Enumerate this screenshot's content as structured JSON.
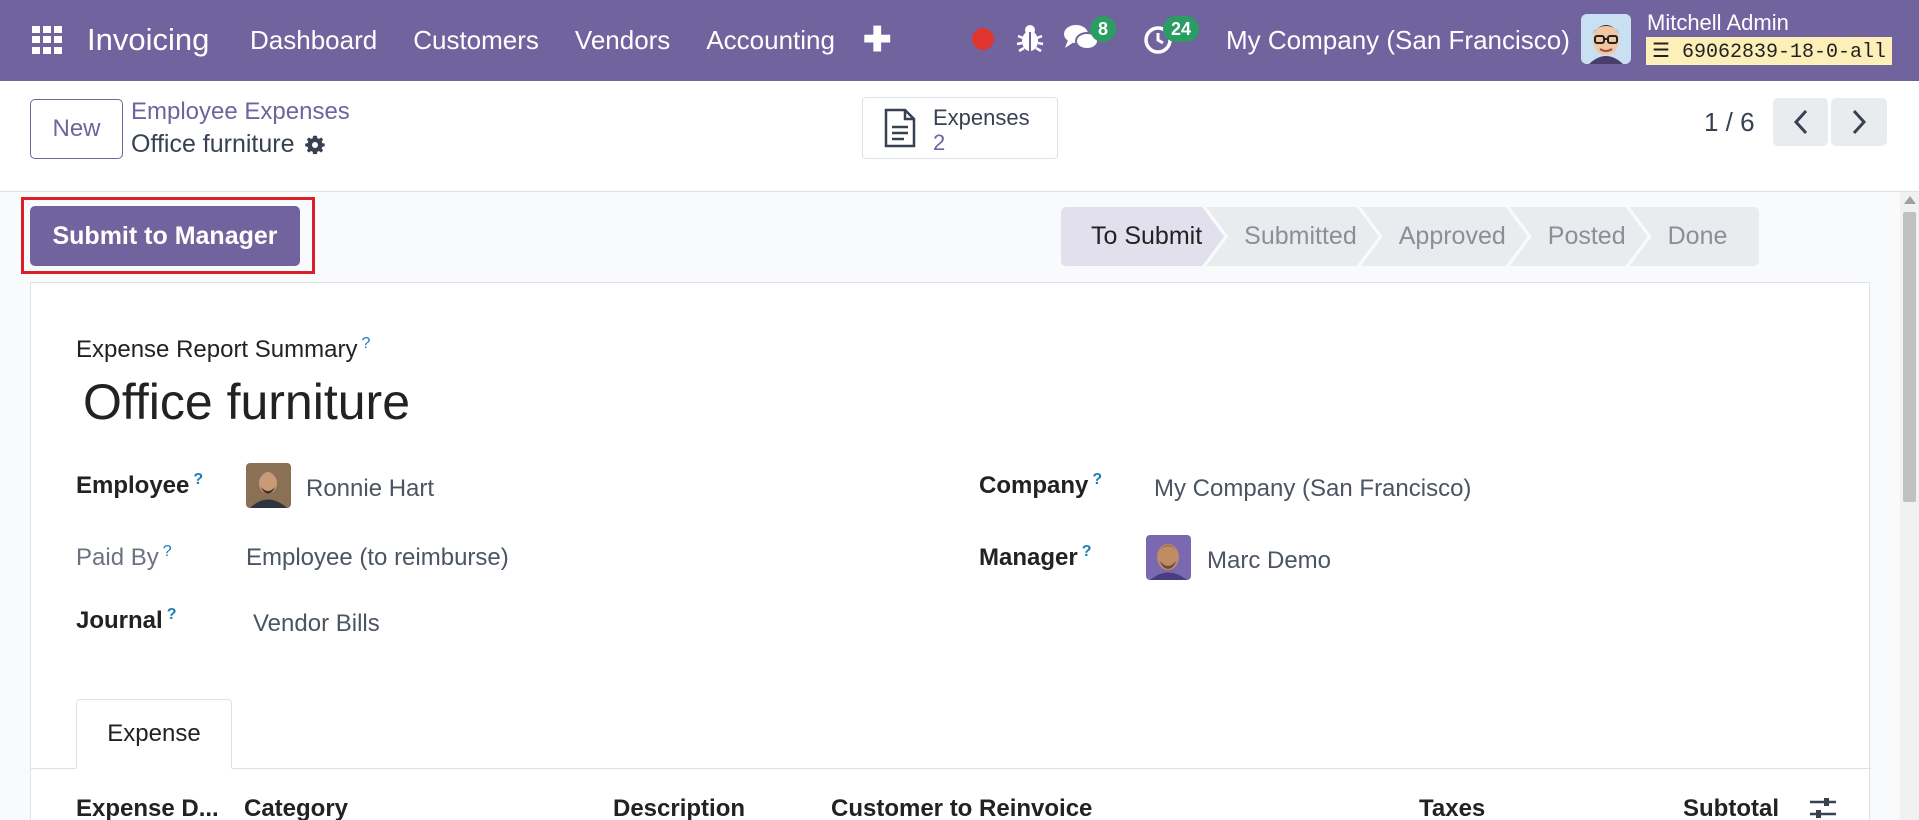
{
  "navbar": {
    "app_name": "Invoicing",
    "menu": [
      "Dashboard",
      "Customers",
      "Vendors",
      "Accounting"
    ],
    "chat_count": "8",
    "activity_count": "24",
    "company": "My Company (San Francisco)",
    "user_name": "Mitchell Admin",
    "db_name": "69062839-18-0-all",
    "accent_color": "#71639e"
  },
  "control": {
    "new_label": "New",
    "breadcrumb_parent": "Employee Expenses",
    "breadcrumb_current": "Office furniture",
    "smart_button": {
      "label": "Expenses",
      "value": "2"
    },
    "pager": "1 / 6"
  },
  "actions": {
    "submit_label": "Submit to Manager"
  },
  "statusbar": {
    "stages": [
      "To Submit",
      "Submitted",
      "Approved",
      "Posted",
      "Done"
    ],
    "active": "To Submit"
  },
  "form": {
    "summary_label": "Expense Report Summary",
    "title": "Office furniture",
    "employee_label": "Employee",
    "employee_value": "Ronnie Hart",
    "paid_by_label": "Paid By",
    "paid_by_value": "Employee (to reimburse)",
    "journal_label": "Journal",
    "journal_value": "Vendor Bills",
    "company_label": "Company",
    "company_value": "My Company (San Francisco)",
    "manager_label": "Manager",
    "manager_value": "Marc Demo",
    "help_mark": "?"
  },
  "tabs": [
    "Expense"
  ],
  "table": {
    "columns": [
      "Expense D...",
      "Category",
      "Description",
      "Customer to Reinvoice",
      "Taxes",
      "Subtotal"
    ]
  }
}
